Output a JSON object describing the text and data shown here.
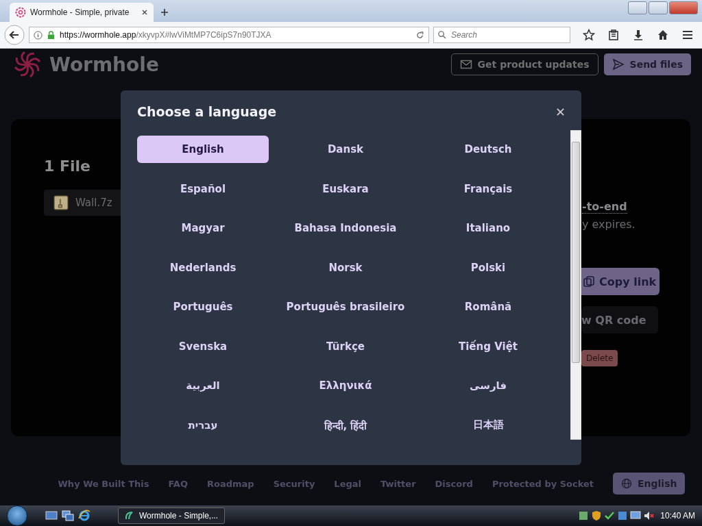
{
  "browser": {
    "tab_title": "Wormhole - Simple, private",
    "url_host": "https://wormhole.app",
    "url_path": "/xkyvpX#lwViMtMP7C6ipS7n90TJXA",
    "search_placeholder": "Search"
  },
  "header": {
    "brand": "Wormhole",
    "buttons": [
      {
        "label": "Get product updates",
        "kind": "outline"
      },
      {
        "label": "Send files",
        "kind": "filled"
      }
    ]
  },
  "card": {
    "heading": "1 File",
    "file": "Wall.7z",
    "link_text": "-to-end",
    "note": "y expires.",
    "copy_button": "Copy link",
    "qr_button": "w QR code",
    "delete_button": "Delete"
  },
  "modal": {
    "title": "Choose a language",
    "languages": [
      {
        "label": "English",
        "selected": true
      },
      {
        "label": "Dansk",
        "selected": false
      },
      {
        "label": "Deutsch",
        "selected": false
      },
      {
        "label": "Español",
        "selected": false
      },
      {
        "label": "Euskara",
        "selected": false
      },
      {
        "label": "Français",
        "selected": false
      },
      {
        "label": "Magyar",
        "selected": false
      },
      {
        "label": "Bahasa Indonesia",
        "selected": false
      },
      {
        "label": "Italiano",
        "selected": false
      },
      {
        "label": "Nederlands",
        "selected": false
      },
      {
        "label": "Norsk",
        "selected": false
      },
      {
        "label": "Polski",
        "selected": false
      },
      {
        "label": "Português",
        "selected": false
      },
      {
        "label": "Português brasileiro",
        "selected": false
      },
      {
        "label": "Română",
        "selected": false
      },
      {
        "label": "Svenska",
        "selected": false
      },
      {
        "label": "Türkçe",
        "selected": false
      },
      {
        "label": "Tiếng Việt",
        "selected": false
      },
      {
        "label": "العربية",
        "selected": false
      },
      {
        "label": "Ελληνικά",
        "selected": false
      },
      {
        "label": "فارسی",
        "selected": false
      },
      {
        "label": "עברית",
        "selected": false
      },
      {
        "label": "हिन्दी, हिंदी",
        "selected": false
      },
      {
        "label": "日本語",
        "selected": false
      }
    ]
  },
  "footer": {
    "links": [
      "Why We Built This",
      "FAQ",
      "Roadmap",
      "Security",
      "Legal",
      "Twitter",
      "Discord",
      "Protected by Socket"
    ],
    "language_button": "English"
  },
  "taskbar": {
    "task": "Wormhole - Simple,...",
    "time": "10:40 AM"
  }
}
